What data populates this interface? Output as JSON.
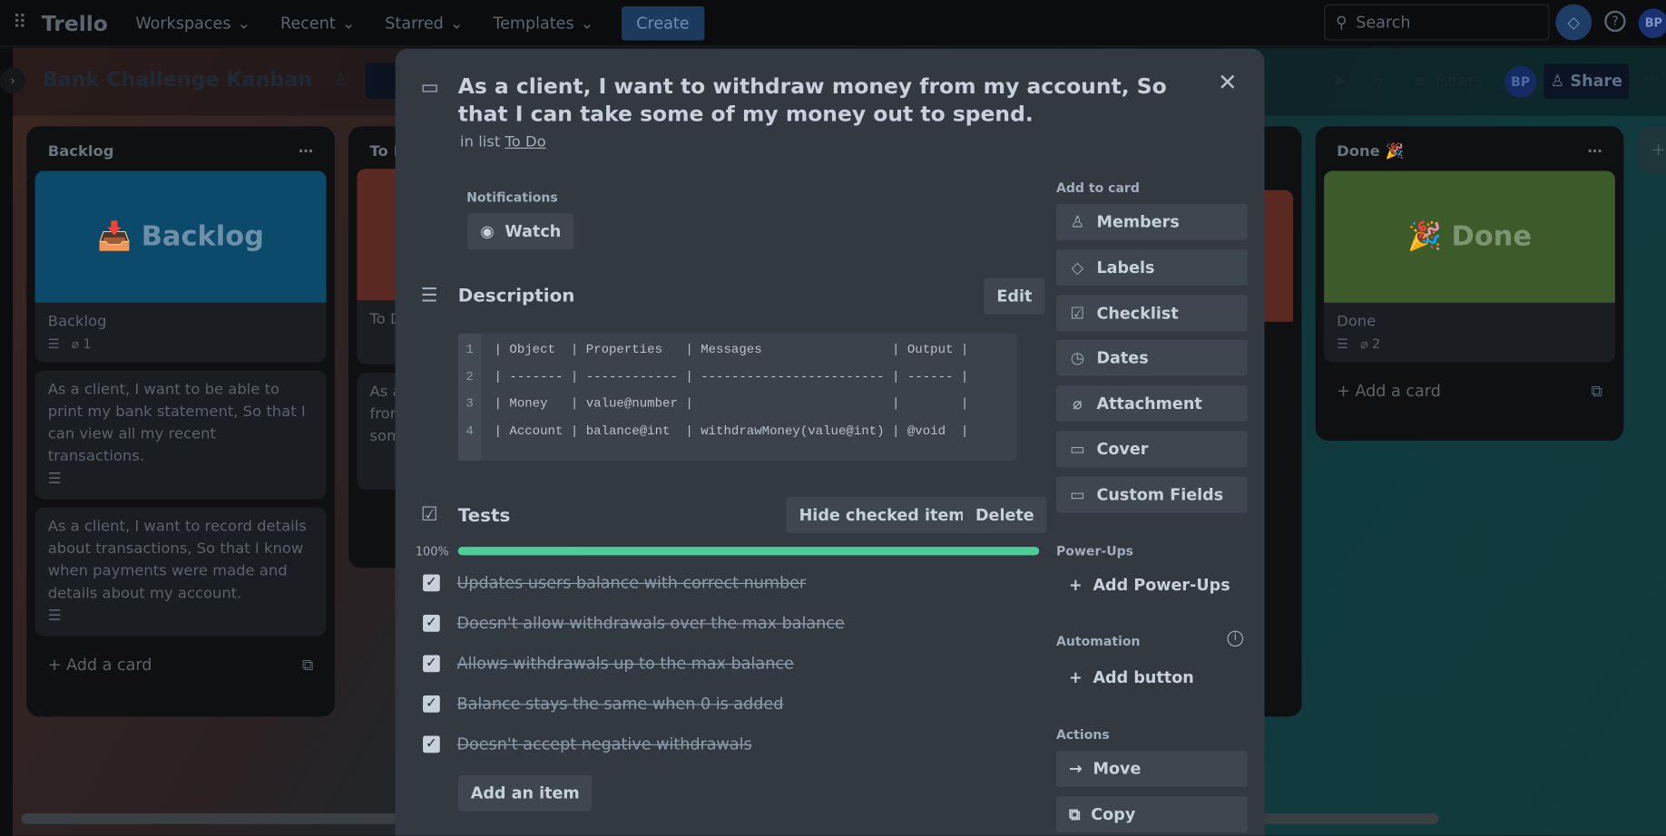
{
  "nav": {
    "logo": "Trello",
    "items": [
      "Workspaces",
      "Recent",
      "Starred",
      "Templates"
    ],
    "create": "Create",
    "search_placeholder": "Search",
    "avatar": "BP"
  },
  "board": {
    "title": "Bank Challenge Kanban",
    "filters": "Filters",
    "share": "Share",
    "avatar": "BP"
  },
  "lists": [
    {
      "title": "Backlog",
      "cover_text": "Backlog",
      "cover_emoji": "📥",
      "cover_color": "#0b4a6b",
      "card_title": "Backlog",
      "attachments": "1",
      "cards": [
        "As a client, I want to be able to print my bank statement, So that I can view all my recent transactions.",
        "As a client, I want to record details about transactions, So that I know when payments were made and details about my account."
      ],
      "add": "Add a card"
    },
    {
      "title": "To Do",
      "card_title": "To Do",
      "cover_color": "#5a2a22",
      "snippet": [
        "As a",
        "from",
        "som"
      ]
    },
    {
      "title": "Done 🎉",
      "cover_text": "Done",
      "cover_emoji": "🎉",
      "cover_color": "#3c5a2a",
      "card_title": "Done",
      "attachments": "2",
      "add": "Add a card"
    }
  ],
  "modal": {
    "title": "As a client, I want to withdraw money from my account, So that I can take some of my money out to spend.",
    "in_list_prefix": "in list",
    "list_name": "To Do",
    "notifications_label": "Notifications",
    "watch": "Watch",
    "description_label": "Description",
    "edit": "Edit",
    "code_lines": [
      {
        "n": "1",
        "text": "| Object  | Properties   | Messages                 | Output |"
      },
      {
        "n": "2",
        "text": "| ------- | ------------ | ------------------------ | ------ |"
      },
      {
        "n": "3",
        "text": "| Money   | value@number |                          |        |"
      },
      {
        "n": "4",
        "text": "| Account | balance@int  | withdrawMoney(value@int) | @void  |"
      }
    ],
    "checklist": {
      "title": "Tests",
      "hide": "Hide checked items",
      "delete": "Delete",
      "progress_label": "100%",
      "progress": 100,
      "progress_color": "#4bce97",
      "items": [
        "Updates users balance with correct number",
        "Doesn't allow withdrawals over the max balance",
        "Allows withdrawals up to the max balance",
        "Balance stays the same when 0 is added",
        "Doesn't accept negative withdrawals"
      ],
      "add_item": "Add an item"
    },
    "sidebar": {
      "add_to_card": "Add to card",
      "buttons": [
        "Members",
        "Labels",
        "Checklist",
        "Dates",
        "Attachment",
        "Cover",
        "Custom Fields"
      ],
      "powerups_label": "Power-Ups",
      "add_powerups": "Add Power-Ups",
      "automation_label": "Automation",
      "add_button": "Add button",
      "actions_label": "Actions",
      "actions": [
        "Move",
        "Copy"
      ]
    }
  }
}
